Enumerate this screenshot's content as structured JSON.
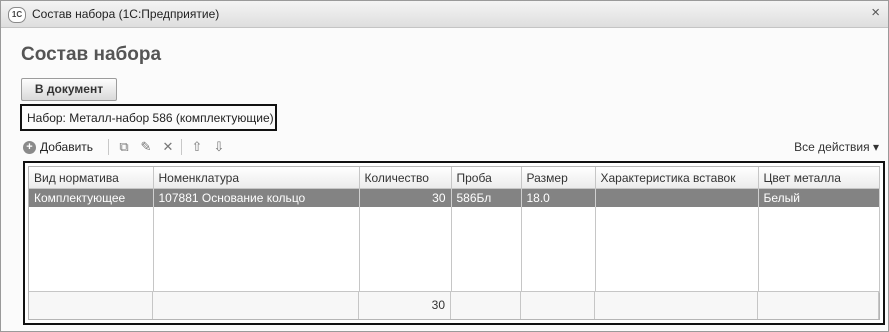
{
  "window": {
    "app_icon": "1С",
    "title": "Состав набора  (1С:Предприятие)",
    "close_glyph": "×"
  },
  "form": {
    "title": "Состав набора",
    "to_document_button": "В документ",
    "nabor_label": "Набор: Металл-набор 586 (комплектующие)"
  },
  "toolbar": {
    "add_label": "Добавить",
    "icons": [
      "plus-icon",
      "copy-icon",
      "edit-icon",
      "delete-icon",
      "move-up-icon",
      "move-down-icon"
    ],
    "all_actions": "Все действия ▾"
  },
  "table": {
    "columns": [
      "Вид норматива",
      "Номенклатура",
      "Количество",
      "Проба",
      "Размер",
      "Характеристика вставок",
      "Цвет металла"
    ],
    "rows": [
      {
        "vid": "Комплектующее",
        "nomenklatura": "107881 Основание кольцо",
        "kolichestvo": "30",
        "proba": "586Бл",
        "razmer": "18.0",
        "harakteristika": "",
        "cvet": "Белый"
      }
    ],
    "total_kolichestvo": "30"
  }
}
